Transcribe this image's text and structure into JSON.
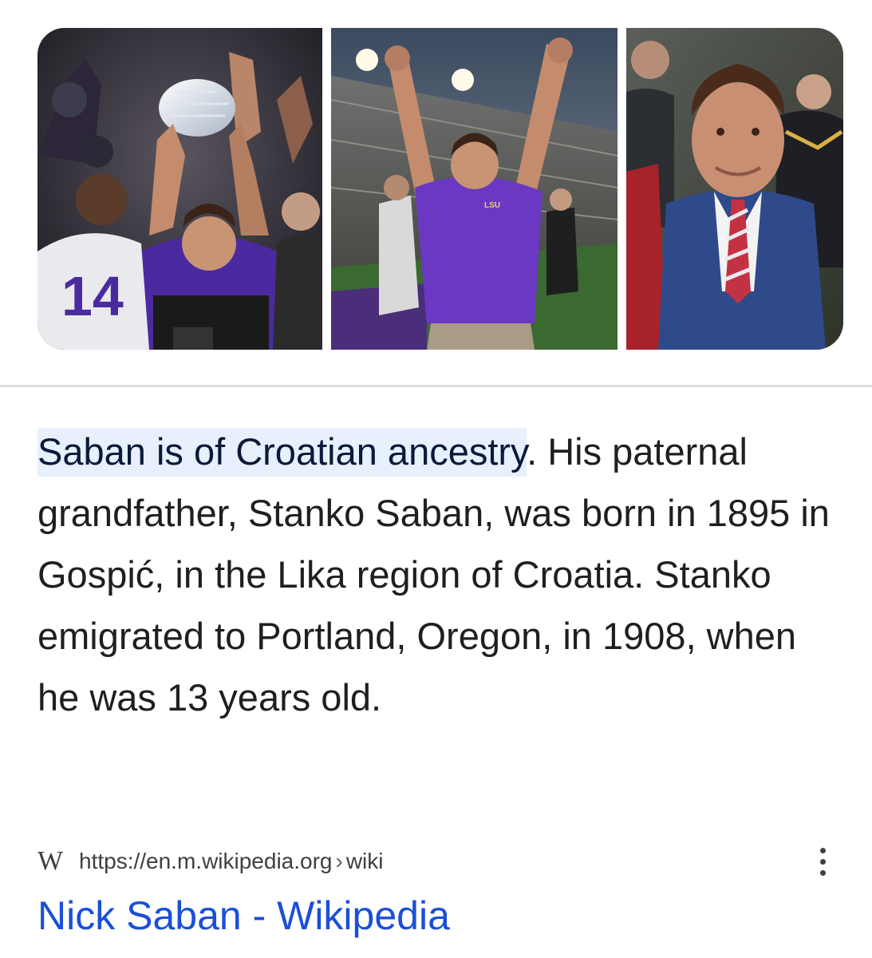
{
  "images": [
    {
      "name": "trophy-celebration-photo",
      "jersey_number": "14"
    },
    {
      "name": "stadium-arms-raised-photo",
      "shirt_text": "LSU"
    },
    {
      "name": "portrait-suit-photo"
    }
  ],
  "snippet": {
    "highlight": "Saban is of Croatian ancestry",
    "rest": ". His paternal grandfather, Stanko Saban, was born in 1895 in Gospić, in the Lika region of Croatia. Stanko emigrated to Portland, Oregon, in 1908, when he was 13 years old."
  },
  "source": {
    "logo_text": "W",
    "domain": "https://en.m.wikipedia.org",
    "separator": "›",
    "path": "wiki"
  },
  "result": {
    "title": "Nick Saban - Wikipedia"
  },
  "colors": {
    "link_blue": "#1a4fd8",
    "highlight_bg": "#e8effd",
    "divider": "#dadce0"
  }
}
